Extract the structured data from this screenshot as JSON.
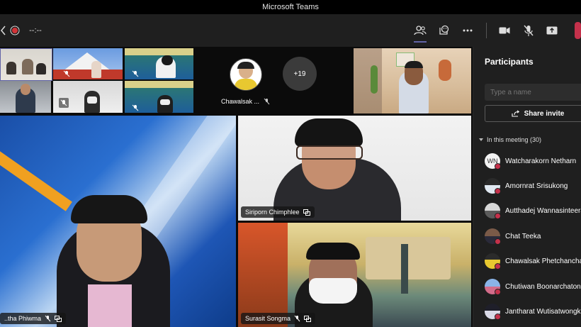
{
  "window": {
    "title": "Microsoft Teams"
  },
  "toolbar": {
    "timer": "--:--",
    "icons": [
      "participants-icon",
      "reactions-icon",
      "more-icon",
      "camera-icon",
      "mic-off-icon",
      "share-icon",
      "leave-icon"
    ]
  },
  "gallery": {
    "overflow_count": "+19",
    "featured_avatar_name": "Chawalsak ..."
  },
  "tiles": {
    "main_speaker": "..tha Phiwma",
    "speaker_two": "Siriporn Chimphlee",
    "speaker_three": "Surasit Songma"
  },
  "participants": {
    "title": "Participants",
    "search_placeholder": "Type a name",
    "share_invite": "Share invite",
    "section_label": "In this meeting (30)",
    "people": [
      {
        "name": "Watcharakorn Netharn",
        "initials": "WN"
      },
      {
        "name": "Amornrat Srisukong",
        "initials": ""
      },
      {
        "name": "Autthadej Wannasinteera...",
        "initials": ""
      },
      {
        "name": "Chat Teeka",
        "initials": ""
      },
      {
        "name": "Chawalsak Phetchanchai",
        "initials": ""
      },
      {
        "name": "Chutiwan Boonarchatong",
        "initials": ""
      },
      {
        "name": "Jantharat Wutisatwongku...",
        "initials": ""
      }
    ]
  },
  "colors": {
    "accent": "#6264a7",
    "leave": "#c4314b",
    "panel": "#1f1f1f"
  }
}
